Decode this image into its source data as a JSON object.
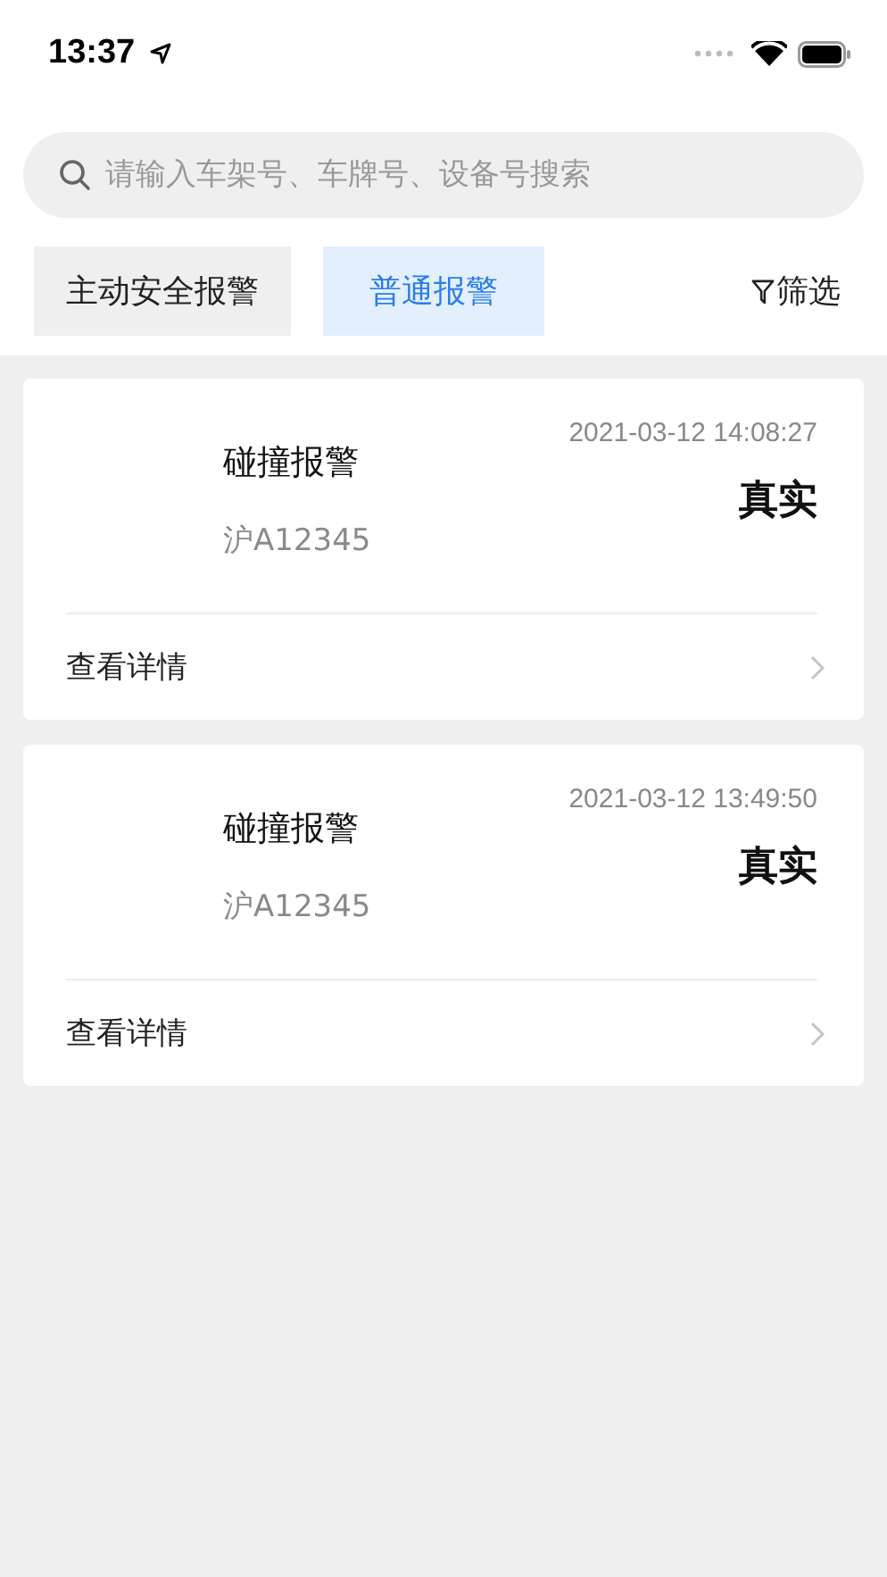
{
  "status_bar": {
    "time": "13:37"
  },
  "search": {
    "placeholder": "请输入车架号、车牌号、设备号搜索"
  },
  "tabs": [
    {
      "label": "主动安全报警",
      "selected": false
    },
    {
      "label": "普通报警",
      "selected": true
    }
  ],
  "filter": {
    "label": "筛选"
  },
  "alarms": [
    {
      "title": "碰撞报警",
      "plate": "沪A12345",
      "time": "2021-03-12 14:08:27",
      "verdict": "真实",
      "link": "查看详情"
    },
    {
      "title": "碰撞报警",
      "plate": "沪A12345",
      "time": "2021-03-12 13:49:50",
      "verdict": "真实",
      "link": "查看详情"
    }
  ]
}
